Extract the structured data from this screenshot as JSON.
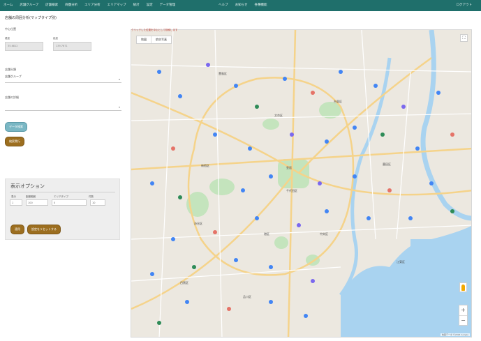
{
  "nav": {
    "items": [
      "ホーム",
      "店舗グループ",
      "店舗検索",
      "商圏分析",
      "エリア分析",
      "エリアマップ",
      "統計",
      "設定",
      "データ管理"
    ],
    "right_items": [
      "ヘルプ",
      "お知らせ",
      "各種機能"
    ],
    "end_item": "ログアウト"
  },
  "left": {
    "page_title": "店舗の周囲分析(マップタイプ別)",
    "location_label": "中心位置",
    "lat_label": "緯度",
    "lat_value": "35.6812",
    "lng_label": "経度",
    "lng_value": "139.7671",
    "group_label": "店舗分類",
    "group_value": "店舗グループ",
    "type_label": "店舗の詳細",
    "type_value": "",
    "search_button": "データ検索",
    "apply_button": "検索実行"
  },
  "options": {
    "title": "表示オプション",
    "labels": [
      "表示",
      "距離範囲",
      "エリアタイプ",
      "件数"
    ],
    "values": [
      "1",
      "100",
      "0",
      "10"
    ],
    "apply_button": "適用",
    "reset_button": "設定をリセットする"
  },
  "map": {
    "caption": "クリックした位置を中心として検索します",
    "tab_map": "地図",
    "tab_satellite": "航空写真",
    "zoom_in": "+",
    "zoom_out": "−",
    "attribution": "地図データ ©2024 Google",
    "labels": {
      "shinjuku": "新宿区",
      "chiyoda": "千代田区",
      "bunkyo": "文京区",
      "taito": "台東区",
      "shibuya": "渋谷区",
      "minato": "港区",
      "chuo": "中央区",
      "koto": "江東区",
      "shinagawa": "品川区",
      "meguro": "目黒区",
      "sumida": "墨田区",
      "toshima": "豊島区",
      "imperial": "皇居"
    }
  },
  "colors": {
    "nav": "#1f6f6b",
    "water": "#a9d3f0",
    "park": "#c4e4bd",
    "brown_button": "#9c6e1f",
    "teal_button": "#7ab7c4"
  }
}
